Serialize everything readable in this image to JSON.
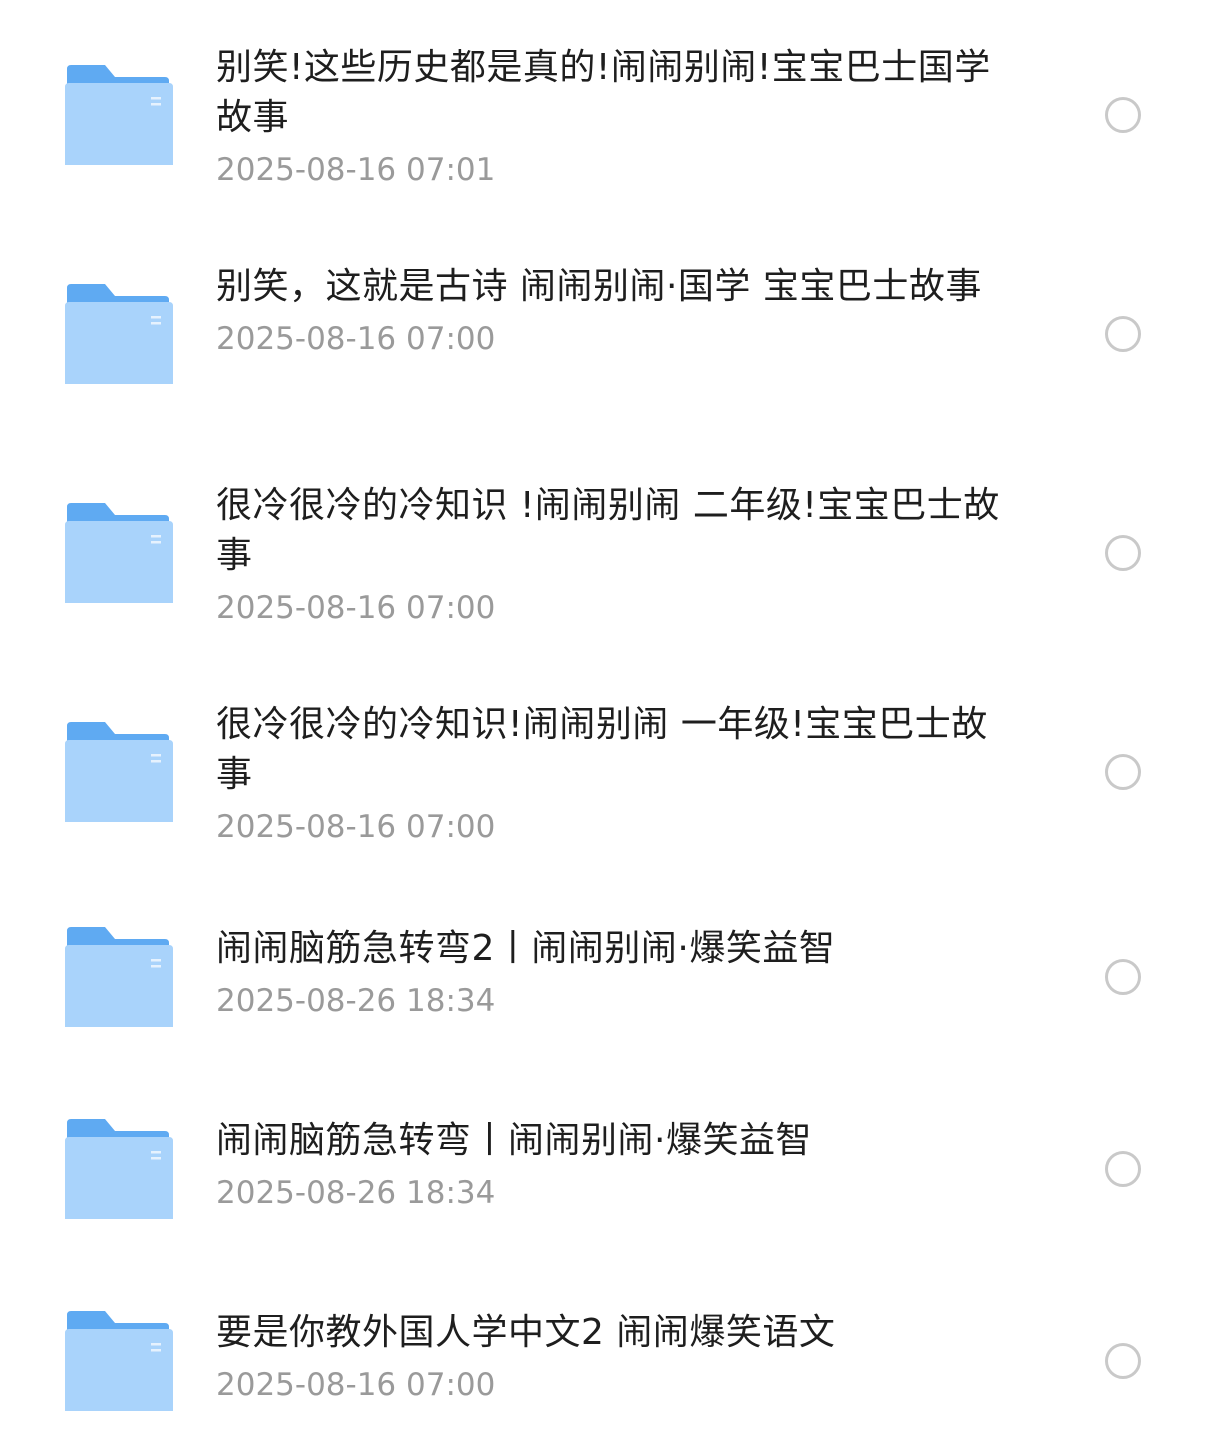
{
  "colors": {
    "folder_body": "#a9d3fb",
    "folder_body_light": "#b9dcfc",
    "folder_tab": "#5faaf2",
    "title_text": "#1e1e1e",
    "date_text": "#9a9a9a",
    "radio_border": "#c9c9c9"
  },
  "icons": {
    "folder": "folder-icon",
    "select": "radio-unchecked-icon"
  },
  "items": [
    {
      "title": "别笑!这些历史都是真的!闹闹别闹!宝宝巴士国学故事",
      "date": "2025-08-16 07:01",
      "selected": false
    },
    {
      "title": "别笑，这就是古诗 闹闹别闹·国学 宝宝巴士故事",
      "date": "2025-08-16 07:00",
      "selected": false
    },
    {
      "title": "很冷很冷的冷知识 !闹闹别闹 二年级!宝宝巴士故事",
      "date": "2025-08-16 07:00",
      "selected": false
    },
    {
      "title": "很冷很冷的冷知识!闹闹别闹 一年级!宝宝巴士故事",
      "date": "2025-08-16 07:00",
      "selected": false
    },
    {
      "title": "闹闹脑筋急转弯2丨闹闹别闹·爆笑益智",
      "date": "2025-08-26 18:34",
      "selected": false
    },
    {
      "title": "闹闹脑筋急转弯丨闹闹别闹·爆笑益智",
      "date": "2025-08-26 18:34",
      "selected": false
    },
    {
      "title": "要是你教外国人学中文2 闹闹爆笑语文",
      "date": "2025-08-16 07:00",
      "selected": false
    }
  ]
}
